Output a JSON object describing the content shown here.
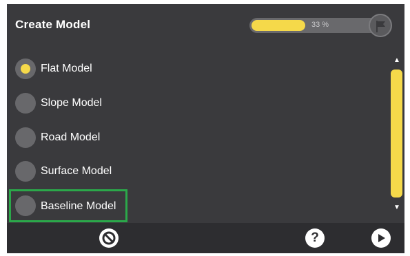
{
  "header": {
    "title": "Create Model",
    "progress": {
      "text": "33 %",
      "fraction": 0.33
    },
    "finish_icon": "flag-icon"
  },
  "options": [
    {
      "label": "Flat Model",
      "selected": true
    },
    {
      "label": "Slope Model",
      "selected": false
    },
    {
      "label": "Road Model",
      "selected": false
    },
    {
      "label": "Surface Model",
      "selected": false
    },
    {
      "label": "Baseline Model",
      "selected": false,
      "focused": true
    }
  ],
  "scrollbar": {
    "up_icon": "arrow-up-icon",
    "down_icon": "arrow-down-icon"
  },
  "footer": {
    "cancel_icon": "cancel-icon",
    "help_icon": "help-icon",
    "next_icon": "play-next-icon"
  },
  "colors": {
    "background": "#3a3a3d",
    "accent": "#f5d94a",
    "focus": "#2ba84a",
    "footer": "#2d2d30"
  }
}
